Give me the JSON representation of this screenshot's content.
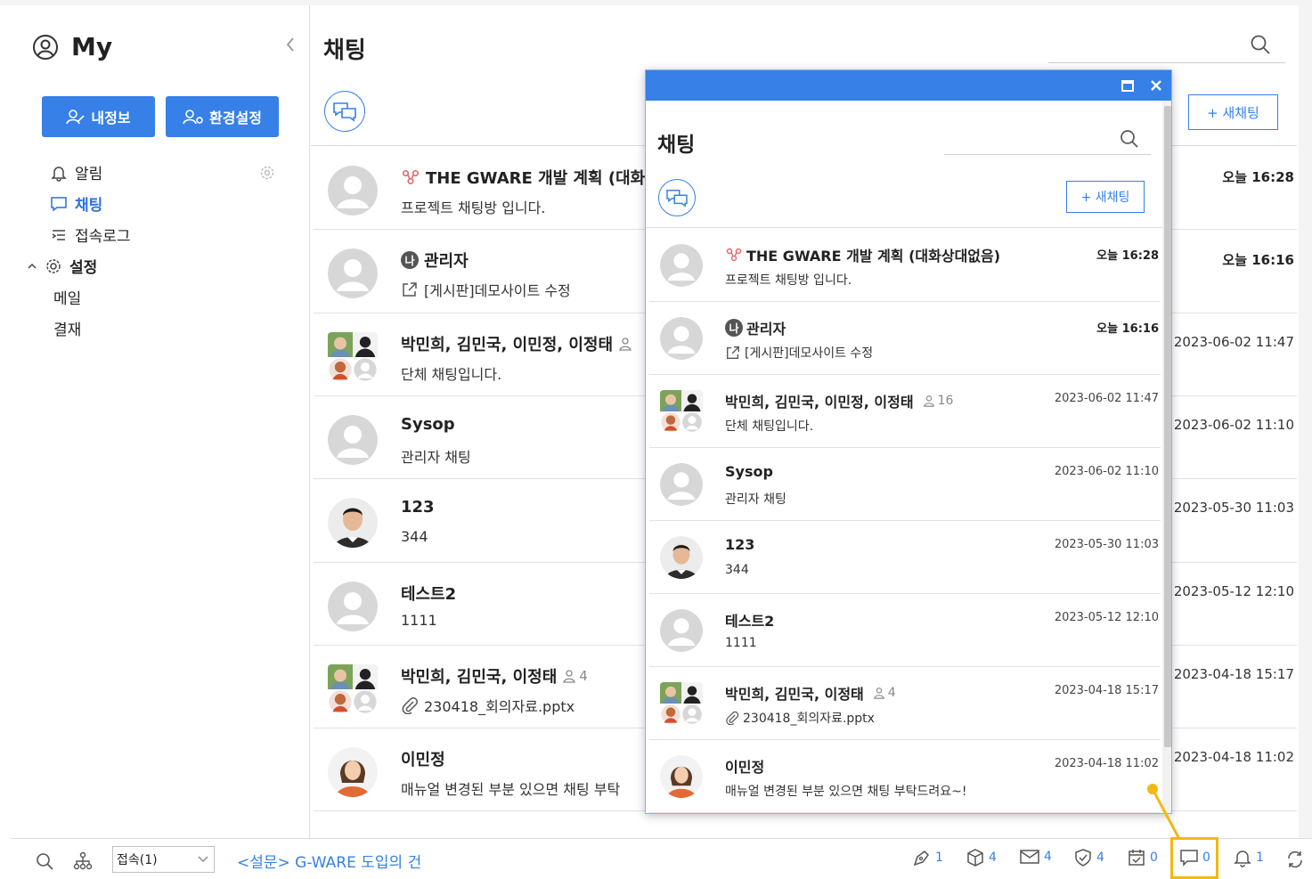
{
  "sidebar": {
    "title": "My",
    "btn_profile": "내정보",
    "btn_settings": "환경설정",
    "menu": [
      {
        "label": "알림"
      },
      {
        "label": "채팅"
      },
      {
        "label": "접속로그"
      },
      {
        "label": "설정"
      },
      {
        "label": "메일"
      },
      {
        "label": "결재"
      }
    ]
  },
  "main": {
    "title": "채팅",
    "new_chat_label": "+ 새채팅",
    "rows": [
      {
        "name": "THE GWARE 개발 계획 (대화상",
        "msg": "프로젝트 채팅방 입니다.",
        "time": "오늘 16:28"
      },
      {
        "name": "관리자",
        "msg": "[게시판]데모사이트 수정",
        "time": "오늘 16:16",
        "tag": "나"
      },
      {
        "name": "박민희, 김민국, 이민정, 이정태",
        "msg": "단체 채팅입니다.",
        "time": "2023-06-02 11:47"
      },
      {
        "name": "Sysop",
        "msg": "관리자 채팅",
        "time": "2023-06-02 11:10"
      },
      {
        "name": "123",
        "msg": "344",
        "time": "2023-05-30 11:03"
      },
      {
        "name": "테스트2",
        "msg": "1111",
        "time": "2023-05-12 12:10"
      },
      {
        "name": "박민희, 김민국, 이정태",
        "members": "4",
        "msg": "230418_회의자료.pptx",
        "time": "2023-04-18 15:17"
      },
      {
        "name": "이민정",
        "msg": "매뉴얼 변경된 부분 있으면 채팅 부탁",
        "time": "2023-04-18 11:02"
      }
    ]
  },
  "popup": {
    "title": "채팅",
    "new_chat_label": "+ 새채팅",
    "rows": [
      {
        "name": "THE GWARE 개발 계획 (대화상대없음)",
        "msg": "프로젝트 채팅방 입니다.",
        "time": "오늘 16:28"
      },
      {
        "name": "관리자",
        "msg": "[게시판]데모사이트 수정",
        "time": "오늘 16:16",
        "tag": "나"
      },
      {
        "name": "박민희, 김민국, 이민정, 이정태",
        "members": "16",
        "msg": "단체 채팅입니다.",
        "time": "2023-06-02 11:47"
      },
      {
        "name": "Sysop",
        "msg": "관리자 채팅",
        "time": "2023-06-02 11:10"
      },
      {
        "name": "123",
        "msg": "344",
        "time": "2023-05-30 11:03"
      },
      {
        "name": "테스트2",
        "msg": "1111",
        "time": "2023-05-12 12:10"
      },
      {
        "name": "박민희, 김민국, 이정태",
        "members": "4",
        "msg": "230418_회의자료.pptx",
        "time": "2023-04-18 15:17"
      },
      {
        "name": "이민정",
        "msg": "매뉴얼 변경된 부분 있으면 채팅 부탁드려요~!",
        "time": "2023-04-18 11:02"
      }
    ]
  },
  "bottom": {
    "select_value": "접속(1)",
    "survey_link": "<설문> G-WARE 도입의 건",
    "counts": {
      "pen": "1",
      "box": "4",
      "mail": "4",
      "shield": "4",
      "calendar": "0",
      "chat": "0",
      "bell": "1"
    }
  },
  "colors": {
    "accent": "#3680e8",
    "highlight": "#f2b814"
  }
}
